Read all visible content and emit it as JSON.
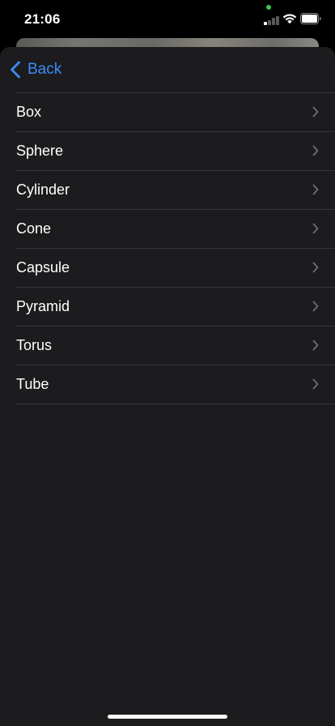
{
  "status_bar": {
    "time": "21:06",
    "signal_bars_active": 1,
    "signal_bars_total": 4,
    "colors": {
      "privacy_dot": "#34c759"
    }
  },
  "nav": {
    "back_label": "Back",
    "back_icon": "chevron-left-icon"
  },
  "list": {
    "items": [
      {
        "label": "Box"
      },
      {
        "label": "Sphere"
      },
      {
        "label": "Cylinder"
      },
      {
        "label": "Cone"
      },
      {
        "label": "Capsule"
      },
      {
        "label": "Pyramid"
      },
      {
        "label": "Torus"
      },
      {
        "label": "Tube"
      }
    ],
    "item_icon": "chevron-right-icon"
  },
  "colors": {
    "accent": "#3a8bf5",
    "sheet_background": "#1c1c1e",
    "separator": "#38383a",
    "text": "#ffffff"
  }
}
